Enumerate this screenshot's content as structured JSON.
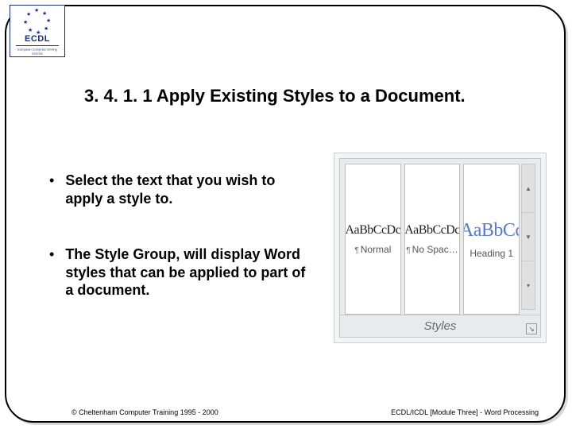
{
  "logo": {
    "acronym": "ECDL",
    "subtitle": "European Computer\nDriving Licence"
  },
  "title": "3. 4. 1. 1 Apply Existing Styles to a Document.",
  "bullets": [
    {
      "text": "Select the text that you wish to apply a style to."
    },
    {
      "text": "The Style Group, will display Word styles that can be applied to part of a document."
    }
  ],
  "gallery": {
    "tiles": [
      {
        "sample": "AaBbCcDc",
        "name": "Normal",
        "kind": "body"
      },
      {
        "sample": "AaBbCcDc",
        "name": "No Spac…",
        "kind": "body"
      },
      {
        "sample": "AaBbCc",
        "name": "Heading 1",
        "kind": "heading"
      }
    ],
    "group_label": "Styles"
  },
  "footer": {
    "left": "© Cheltenham Computer Training 1995 - 2000",
    "right": "ECDL/ICDL [Module Three]  - Word Processing"
  }
}
